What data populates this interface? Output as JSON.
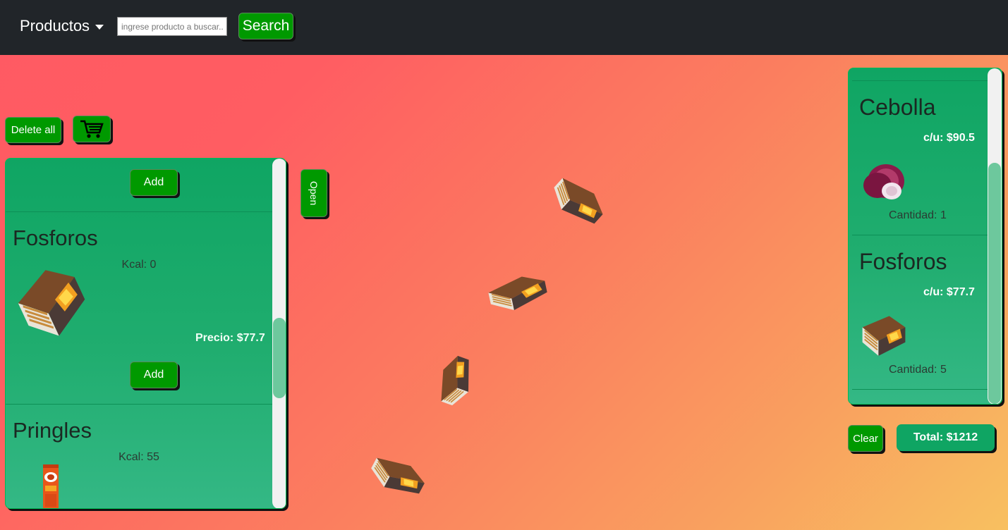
{
  "navbar": {
    "brand_label": "Productos",
    "search_placeholder": "ingrese producto a buscar...",
    "search_label": "Search"
  },
  "actions": {
    "delete_all_label": "Delete all",
    "cart_icon": "cart-icon",
    "open_label": "Open"
  },
  "catalog": {
    "add_label": "Add",
    "products": [
      {
        "name": "Fosforos",
        "kcal": "Kcal: 0",
        "price": "Precio: $77.7",
        "image": "matchbox"
      },
      {
        "name": "Pringles",
        "kcal": "Kcal: 55",
        "image": "pringles-can"
      }
    ]
  },
  "cart": {
    "items": [
      {
        "name": "Cebolla",
        "unit_price": "c/u: $90.5",
        "quantity": "Cantidad: 1",
        "image": "onion"
      },
      {
        "name": "Fosforos",
        "unit_price": "c/u: $77.7",
        "quantity": "Cantidad: 5",
        "image": "matchbox"
      }
    ],
    "clear_label": "Clear",
    "total_label": "Total: $1212"
  },
  "colors": {
    "navbar": "#212529",
    "button_green": "#009900",
    "panel_green": "#0fa563",
    "gradient_start": "#ff5a63",
    "gradient_end": "#f8c060"
  }
}
